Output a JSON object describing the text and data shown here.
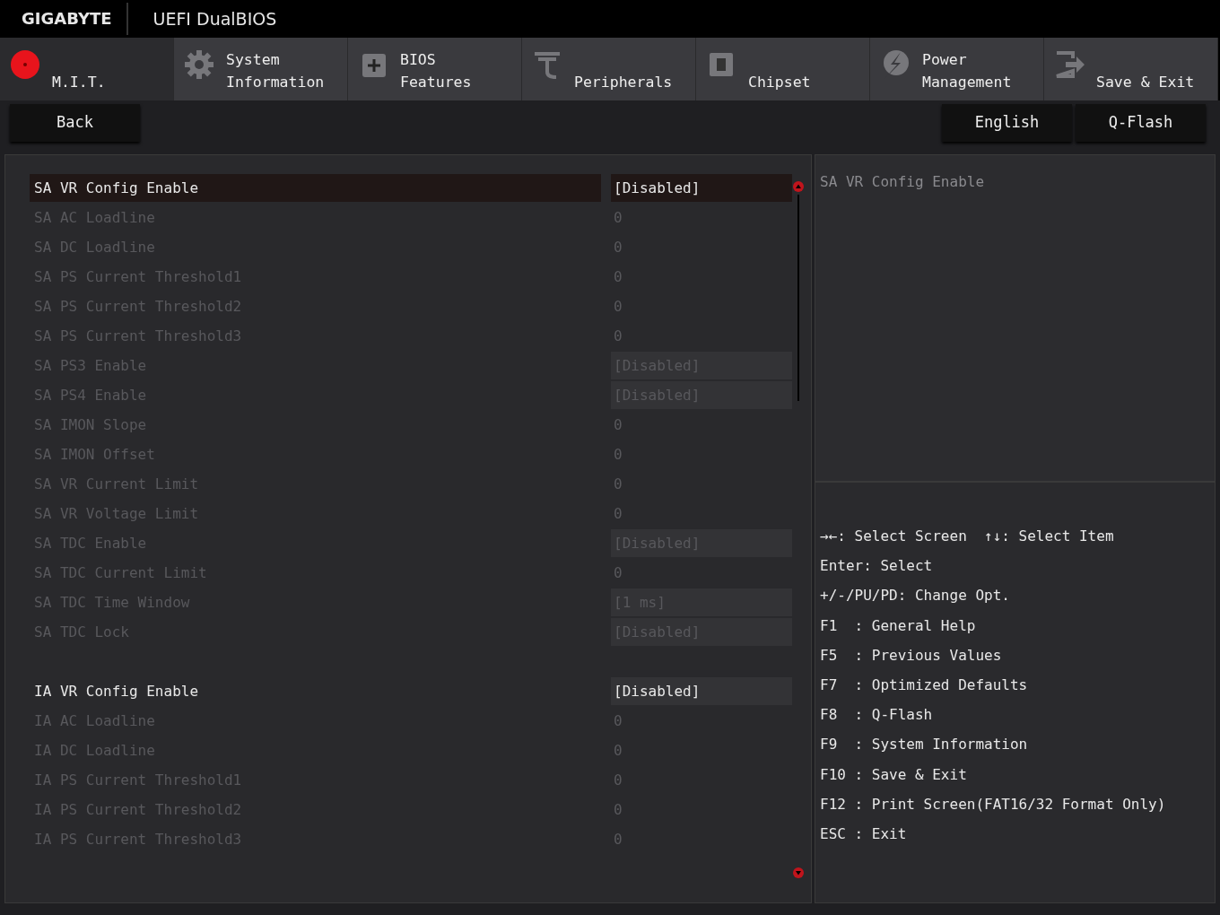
{
  "header": {
    "brand": "GIGABYTE",
    "product": "UEFI DualBIOS"
  },
  "tabs": [
    {
      "label": "M.I.T.",
      "selected": true
    },
    {
      "label": "System Information",
      "selected": false
    },
    {
      "label": "BIOS Features",
      "selected": false
    },
    {
      "label": "Peripherals",
      "selected": false
    },
    {
      "label": "Chipset",
      "selected": false
    },
    {
      "label": "Power Management",
      "selected": false
    },
    {
      "label": "Save & Exit",
      "selected": false
    }
  ],
  "toolbar": {
    "back": "Back",
    "language": "English",
    "qflash": "Q-Flash"
  },
  "setting_groups": [
    [
      {
        "label": "SA VR Config Enable",
        "value": "[Disabled]",
        "kind": "option",
        "disabled": false,
        "selected": true
      },
      {
        "label": "SA AC Loadline",
        "value": "0",
        "kind": "number",
        "disabled": true,
        "selected": false
      },
      {
        "label": "SA DC Loadline",
        "value": "0",
        "kind": "number",
        "disabled": true,
        "selected": false
      },
      {
        "label": "SA PS Current Threshold1",
        "value": "0",
        "kind": "number",
        "disabled": true,
        "selected": false
      },
      {
        "label": "SA PS Current Threshold2",
        "value": "0",
        "kind": "number",
        "disabled": true,
        "selected": false
      },
      {
        "label": "SA PS Current Threshold3",
        "value": "0",
        "kind": "number",
        "disabled": true,
        "selected": false
      },
      {
        "label": "SA PS3 Enable",
        "value": "[Disabled]",
        "kind": "option",
        "disabled": true,
        "selected": false
      },
      {
        "label": "SA PS4 Enable",
        "value": "[Disabled]",
        "kind": "option",
        "disabled": true,
        "selected": false
      },
      {
        "label": "SA IMON Slope",
        "value": "0",
        "kind": "number",
        "disabled": true,
        "selected": false
      },
      {
        "label": "SA IMON Offset",
        "value": "0",
        "kind": "number",
        "disabled": true,
        "selected": false
      },
      {
        "label": "SA VR Current Limit",
        "value": "0",
        "kind": "number",
        "disabled": true,
        "selected": false
      },
      {
        "label": "SA VR Voltage Limit",
        "value": "0",
        "kind": "number",
        "disabled": true,
        "selected": false
      },
      {
        "label": "SA TDC Enable",
        "value": "[Disabled]",
        "kind": "option",
        "disabled": true,
        "selected": false
      },
      {
        "label": "SA TDC Current Limit",
        "value": "0",
        "kind": "number",
        "disabled": true,
        "selected": false
      },
      {
        "label": "SA TDC Time Window",
        "value": "[1 ms]",
        "kind": "option",
        "disabled": true,
        "selected": false
      },
      {
        "label": "SA TDC Lock",
        "value": "[Disabled]",
        "kind": "option",
        "disabled": true,
        "selected": false
      }
    ],
    [
      {
        "label": "IA VR Config Enable",
        "value": "[Disabled]",
        "kind": "option",
        "disabled": false,
        "selected": false
      },
      {
        "label": "IA AC Loadline",
        "value": "0",
        "kind": "number",
        "disabled": true,
        "selected": false
      },
      {
        "label": "IA DC Loadline",
        "value": "0",
        "kind": "number",
        "disabled": true,
        "selected": false
      },
      {
        "label": "IA PS Current Threshold1",
        "value": "0",
        "kind": "number",
        "disabled": true,
        "selected": false
      },
      {
        "label": "IA PS Current Threshold2",
        "value": "0",
        "kind": "number",
        "disabled": true,
        "selected": false
      },
      {
        "label": "IA PS Current Threshold3",
        "value": "0",
        "kind": "number",
        "disabled": true,
        "selected": false
      }
    ]
  ],
  "description": "SA VR Config Enable",
  "help": [
    "→←: Select Screen  ↑↓: Select Item",
    "Enter: Select",
    "+/-/PU/PD: Change Opt.",
    "F1  : General Help",
    "F5  : Previous Values",
    "F7  : Optimized Defaults",
    "F8  : Q-Flash",
    "F9  : System Information",
    "F10 : Save & Exit",
    "F12 : Print Screen(FAT16/32 Format Only)",
    "ESC : Exit"
  ]
}
